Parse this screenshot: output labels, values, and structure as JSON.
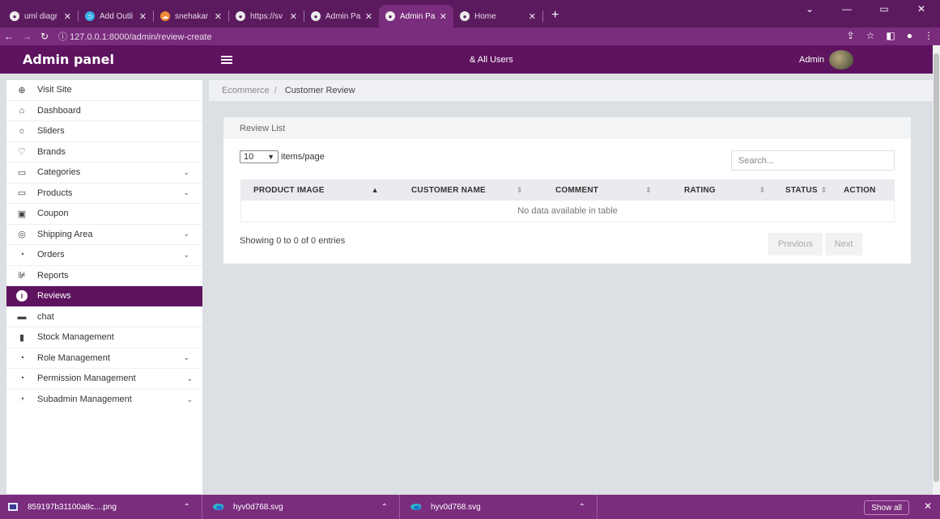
{
  "browser": {
    "tabs": [
      {
        "title": "uml diagr",
        "icon": "chrome-icon"
      },
      {
        "title": "Add Outli",
        "icon": "outline-icon"
      },
      {
        "title": "snehakar",
        "icon": "cloud-icon"
      },
      {
        "title": "https://sv",
        "icon": "chrome-icon"
      },
      {
        "title": "Admin Pa",
        "icon": "chrome-icon"
      },
      {
        "title": "Admin Pa",
        "icon": "chrome-icon",
        "active": true
      },
      {
        "title": "Home",
        "icon": "chrome-icon"
      }
    ],
    "url": "127.0.0.1:8000/admin/review-create"
  },
  "header": {
    "brand": "Admin panel",
    "all_users": "All Users",
    "admin_label": "Admin"
  },
  "sidebar": {
    "items": [
      {
        "label": "Visit Site",
        "icon": "globe-icon"
      },
      {
        "label": "Dashboard",
        "icon": "home-icon"
      },
      {
        "label": "Sliders",
        "icon": "sun-icon"
      },
      {
        "label": "Brands",
        "icon": "heart-icon"
      },
      {
        "label": "Categories",
        "icon": "folder-icon",
        "dropdown": true
      },
      {
        "label": "Products",
        "icon": "folder-icon",
        "dropdown": true
      },
      {
        "label": "Coupon",
        "icon": "calendar-icon"
      },
      {
        "label": "Shipping Area",
        "icon": "location-icon",
        "dropdown": true
      },
      {
        "label": "Orders",
        "icon": "clock-icon",
        "dropdown": true
      },
      {
        "label": "Reports",
        "icon": "report-icon"
      },
      {
        "label": "Reviews",
        "icon": "info-icon",
        "active": true
      },
      {
        "label": "chat",
        "icon": "chat-icon"
      },
      {
        "label": "Stock Management",
        "icon": "bookmark-icon"
      },
      {
        "label": "Role Management",
        "icon": "clock-icon",
        "dropdown": true
      },
      {
        "label": "Permission Management",
        "icon": "clock-icon",
        "dropdown": true
      },
      {
        "label": "Subadmin Management",
        "icon": "clock-icon",
        "dropdown": true
      }
    ]
  },
  "breadcrumb": {
    "parent": "Ecommerce",
    "current": "Customer Review"
  },
  "review_card": {
    "title": "Review List",
    "per_page_value": "10",
    "per_page_label": "items/page",
    "search_placeholder": "Search...",
    "columns": [
      "PRODUCT IMAGE",
      "CUSTOMER NAME",
      "COMMENT",
      "RATING",
      "STATUS",
      "ACTION"
    ],
    "empty_text": "No data available in table",
    "info": "Showing 0 to 0 of 0 entries",
    "prev": "Previous",
    "next": "Next"
  },
  "downloads": {
    "items": [
      "859197b31100a8c....png",
      "hyv0d768.svg",
      "hyv0d768.svg"
    ],
    "show_all": "Show all"
  }
}
